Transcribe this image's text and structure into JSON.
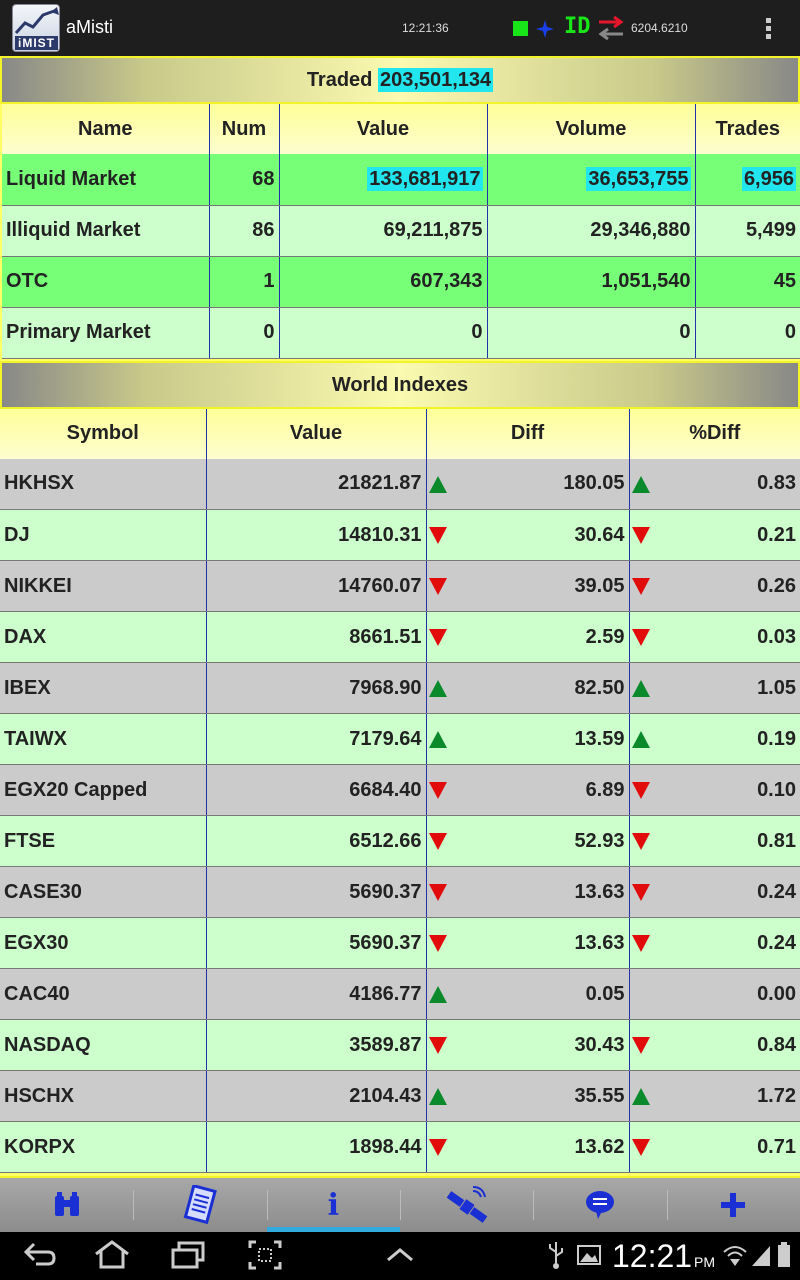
{
  "app": {
    "title": "aMisti",
    "icon_label": "iMIST",
    "clock": "12:21:36",
    "indicator_id": "ID",
    "index_value": "6204.6210"
  },
  "market": {
    "title_prefix": "Traded",
    "traded_total": "203,501,134",
    "columns": [
      "Name",
      "Num",
      "Value",
      "Volume",
      "Trades"
    ],
    "rows": [
      {
        "name": "Liquid Market",
        "num": "68",
        "value": "133,681,917",
        "volume": "36,653,755",
        "trades": "6,956"
      },
      {
        "name": "Illiquid Market",
        "num": "86",
        "value": "69,211,875",
        "volume": "29,346,880",
        "trades": "5,499"
      },
      {
        "name": "OTC",
        "num": "1",
        "value": "607,343",
        "volume": "1,051,540",
        "trades": "45"
      },
      {
        "name": "Primary Market",
        "num": "0",
        "value": "0",
        "volume": "0",
        "trades": "0"
      }
    ]
  },
  "world": {
    "title": "World Indexes",
    "columns": [
      "Symbol",
      "Value",
      "Diff",
      "%Diff"
    ],
    "rows": [
      {
        "symbol": "HKHSX",
        "value": "21821.87",
        "dir": "up",
        "diff": "180.05",
        "pdir": "up",
        "pdiff": "0.83"
      },
      {
        "symbol": "DJ",
        "value": "14810.31",
        "dir": "down",
        "diff": "30.64",
        "pdir": "down",
        "pdiff": "0.21"
      },
      {
        "symbol": "NIKKEI",
        "value": "14760.07",
        "dir": "down",
        "diff": "39.05",
        "pdir": "down",
        "pdiff": "0.26"
      },
      {
        "symbol": "DAX",
        "value": "8661.51",
        "dir": "down",
        "diff": "2.59",
        "pdir": "down",
        "pdiff": "0.03"
      },
      {
        "symbol": "IBEX",
        "value": "7968.90",
        "dir": "up",
        "diff": "82.50",
        "pdir": "up",
        "pdiff": "1.05"
      },
      {
        "symbol": "TAIWX",
        "value": "7179.64",
        "dir": "up",
        "diff": "13.59",
        "pdir": "up",
        "pdiff": "0.19"
      },
      {
        "symbol": "EGX20 Capped",
        "value": "6684.40",
        "dir": "down",
        "diff": "6.89",
        "pdir": "down",
        "pdiff": "0.10"
      },
      {
        "symbol": "FTSE",
        "value": "6512.66",
        "dir": "down",
        "diff": "52.93",
        "pdir": "down",
        "pdiff": "0.81"
      },
      {
        "symbol": "CASE30",
        "value": "5690.37",
        "dir": "down",
        "diff": "13.63",
        "pdir": "down",
        "pdiff": "0.24"
      },
      {
        "symbol": "EGX30",
        "value": "5690.37",
        "dir": "down",
        "diff": "13.63",
        "pdir": "down",
        "pdiff": "0.24"
      },
      {
        "symbol": "CAC40",
        "value": "4186.77",
        "dir": "up",
        "diff": "0.05",
        "pdir": "none",
        "pdiff": "0.00"
      },
      {
        "symbol": "NASDAQ",
        "value": "3589.87",
        "dir": "down",
        "diff": "30.43",
        "pdir": "down",
        "pdiff": "0.84"
      },
      {
        "symbol": "HSCHX",
        "value": "2104.43",
        "dir": "up",
        "diff": "35.55",
        "pdir": "up",
        "pdiff": "1.72"
      },
      {
        "symbol": "KORPX",
        "value": "1898.44",
        "dir": "down",
        "diff": "13.62",
        "pdir": "down",
        "pdiff": "0.71"
      }
    ]
  },
  "colors": {
    "up": "#0b8a2c",
    "down": "#e20b0b",
    "highlight": "#22e6ee",
    "tab_icon": "#1a2fd4"
  },
  "tabs": [
    {
      "icon": "binoculars-icon",
      "label": ""
    },
    {
      "icon": "document-icon",
      "label": ""
    },
    {
      "icon": "info-icon",
      "label": "i",
      "active": true
    },
    {
      "icon": "satellite-icon",
      "label": ""
    },
    {
      "icon": "chat-bubble-icon",
      "label": ""
    },
    {
      "icon": "plus-icon",
      "label": ""
    }
  ],
  "system": {
    "time": "12:21",
    "ampm": "PM"
  }
}
